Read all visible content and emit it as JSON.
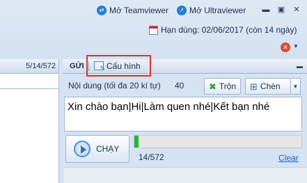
{
  "top_links": {
    "teamviewer": "Mở Teamviewer",
    "ultraviewer": "Mở Ultraviewer"
  },
  "expiry": "Hạn dùng: 02/06/2017 (còn 14 ngày)",
  "left_panel": {
    "header_value": "5/14/572"
  },
  "panel": {
    "title": "GỬI",
    "config_button": "Cấu hình"
  },
  "compose": {
    "content_label": "Nội dung (tối đa 20 kí tự)",
    "char_count": "40",
    "shuffle_button": "Trộn",
    "insert_button": "Chèn",
    "message_text": "Xin chào bạn|Hi|Làm quen nhé|Kết bạn nhé"
  },
  "run": {
    "run_button": "CHẠY",
    "progress_text": "14/572",
    "progress_fraction": 0.0245,
    "clear_link": "Clear"
  },
  "colors": {
    "accent_blue": "#1e7fd6",
    "highlight_red": "#d9342b",
    "progress_green": "#27b33a",
    "link_blue": "#1565c0"
  }
}
